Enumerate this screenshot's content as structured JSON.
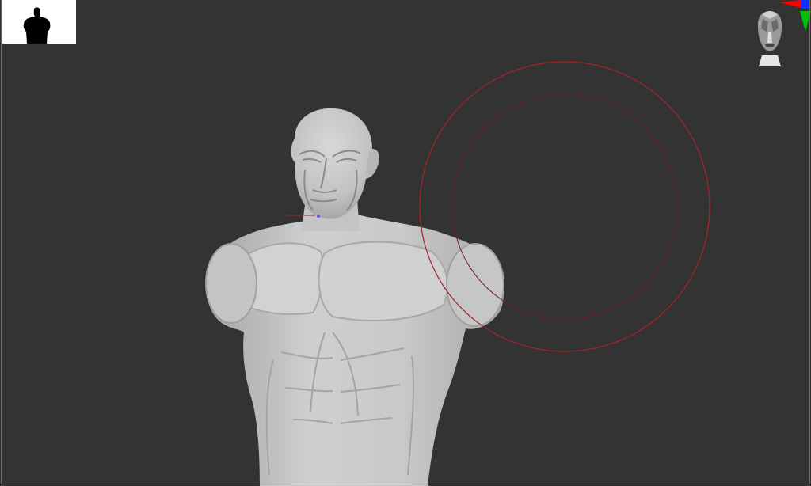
{
  "viewport": {
    "background": "#333333",
    "mode": "3d-sculpt-canvas"
  },
  "model": {
    "subject": "muscular-bust",
    "material_color": "#c8c8c8"
  },
  "brush": {
    "outer_color": "#a8232a",
    "inner_color": "#6e1f22"
  },
  "axis_gizmo": {
    "x_color": "#ff0000",
    "y_color": "#00c000",
    "z_color": "#1030ff"
  },
  "thumbnail": {
    "background": "#ffffff",
    "silhouette_color": "#000000"
  }
}
